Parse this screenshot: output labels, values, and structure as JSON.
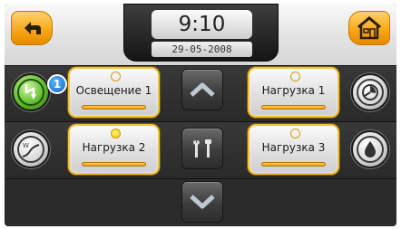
{
  "header": {
    "back_icon": "back-arrow-icon",
    "home_icon": "home-icon",
    "time": "9:10",
    "date": "29-05-2008"
  },
  "side_left": {
    "energy_icon": "lightning-icon",
    "energy_badge": "1",
    "graph_icon": "graph-w-icon"
  },
  "side_right": {
    "gauge_icon": "gauge-icon",
    "water_icon": "water-drop-icon"
  },
  "channels": [
    {
      "label": "Освещение 1",
      "lamp_on": false
    },
    {
      "label": "Нагрузка 2",
      "lamp_on": true
    },
    {
      "label": "Нагрузка 1",
      "lamp_on": false
    },
    {
      "label": "Нагрузка 3",
      "lamp_on": false
    }
  ],
  "center": {
    "up_icon": "chevron-up-icon",
    "tools_icon": "tools-icon",
    "down_icon": "chevron-down-icon"
  },
  "colors": {
    "accent_orange": "#f7a414",
    "frame_gold": "#f3c03a",
    "badge_blue": "#1167c7",
    "energy_green": "#5fbd2a",
    "lamp_on": "#ffc400"
  }
}
